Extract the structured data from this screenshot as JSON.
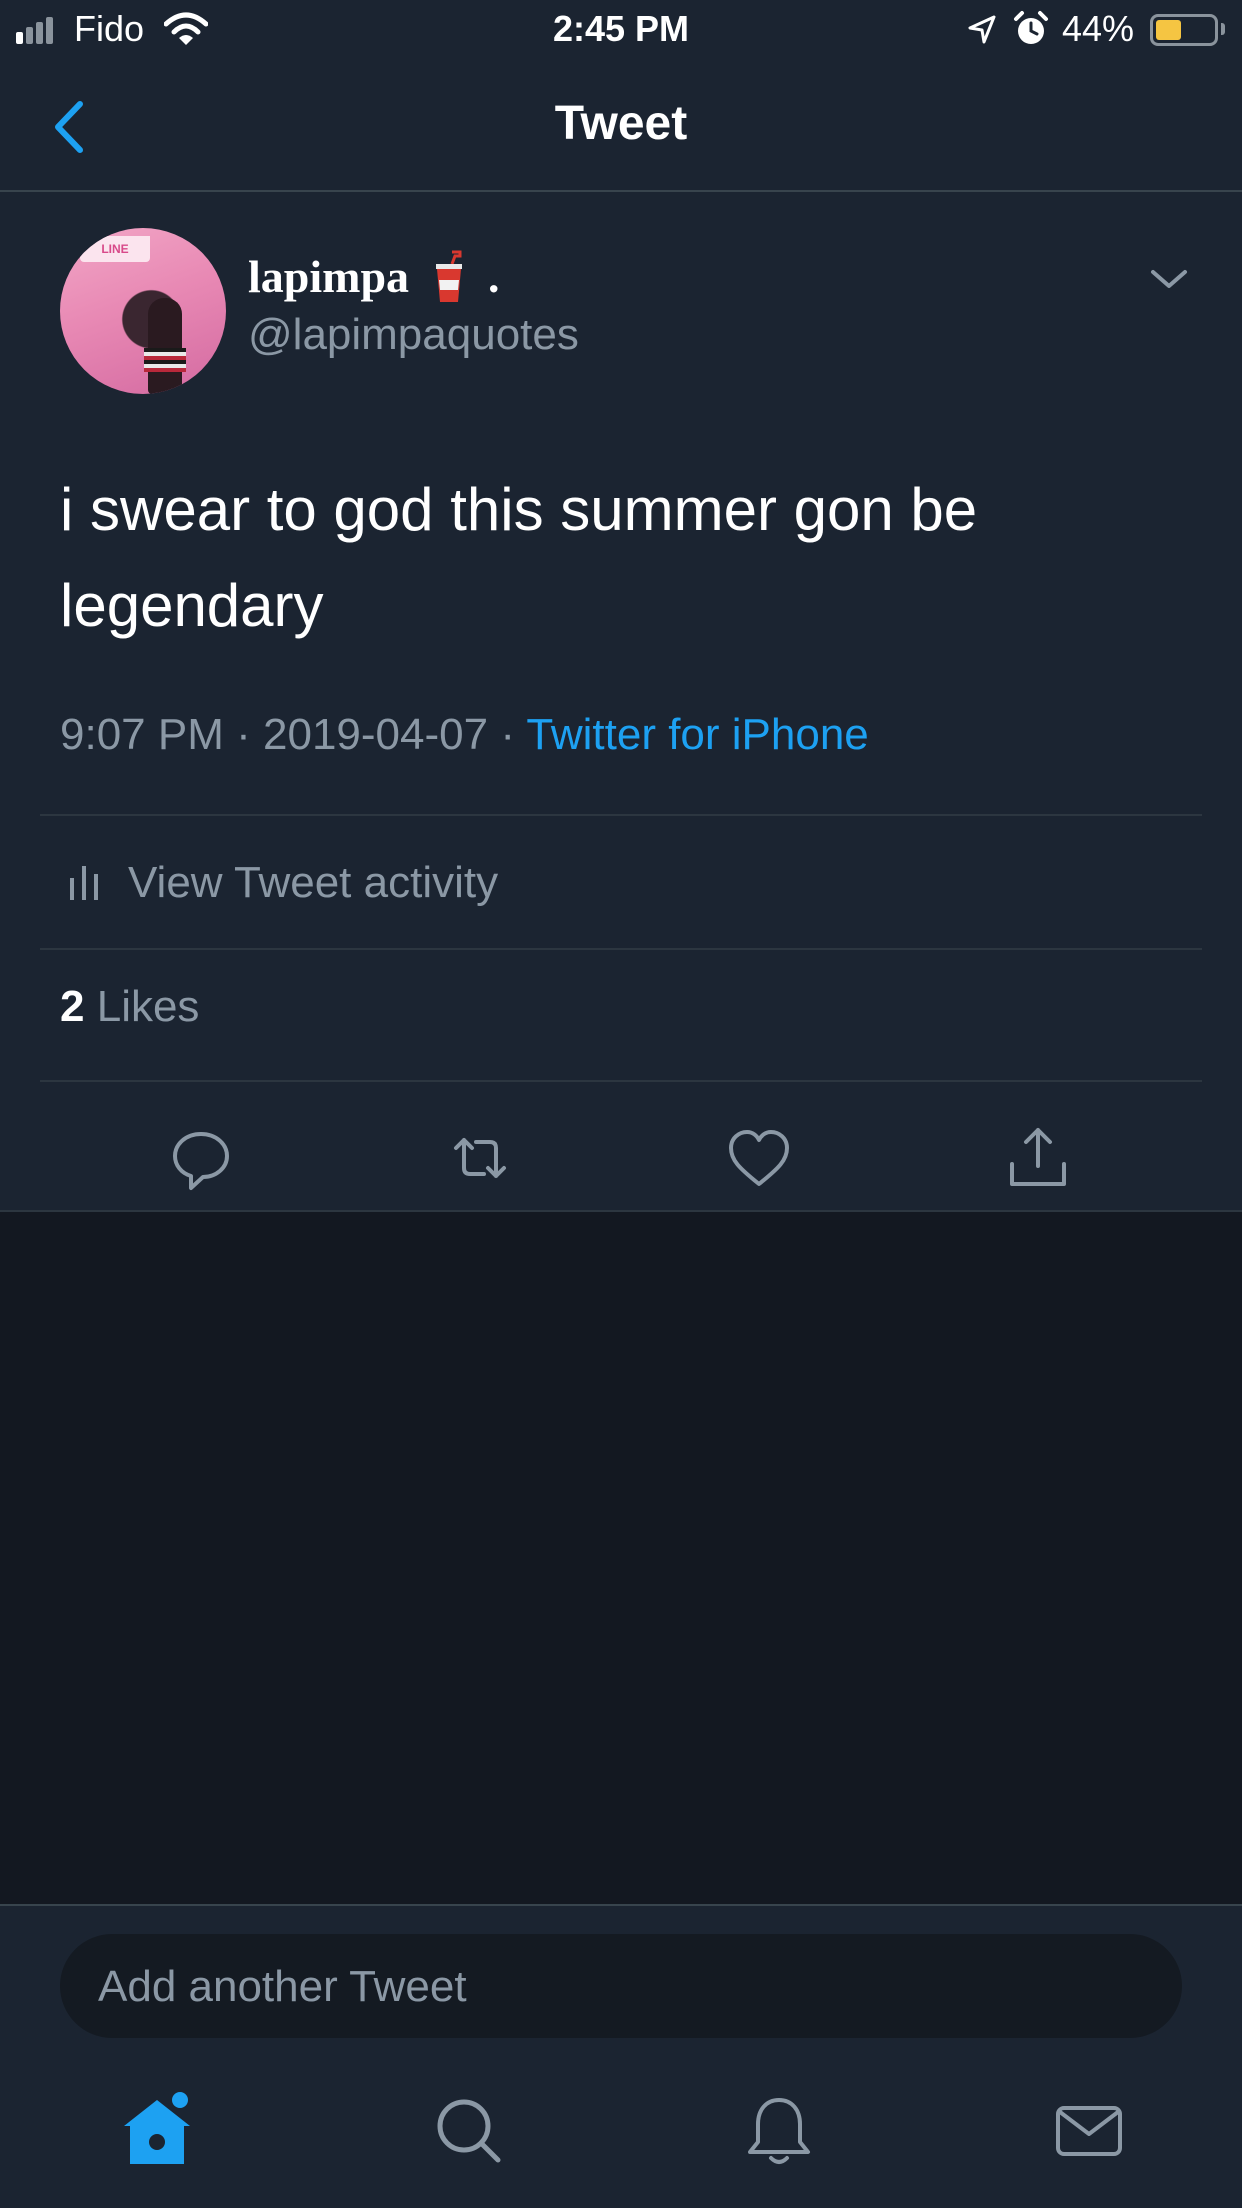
{
  "status_bar": {
    "carrier": "Fido",
    "time": "2:45 PM",
    "battery_percent_label": "44%",
    "battery_level": 0.44,
    "icons": [
      "signal-icon",
      "wifi-icon",
      "location-icon",
      "alarm-icon",
      "battery-icon"
    ]
  },
  "nav": {
    "title": "Tweet",
    "back_icon": "chevron-left-icon"
  },
  "tweet": {
    "author": {
      "display_name": "lapimpa",
      "name_suffix": ".",
      "handle": "@lapimpaquotes",
      "avatar_sign_text": "LINE"
    },
    "text": "i swear to god this summer gon be legendary",
    "time": "9:07 PM",
    "separator": "·",
    "date": "2019-04-07",
    "source": "Twitter for iPhone",
    "activity_label": "View Tweet activity",
    "likes_count": "2",
    "likes_label": "Likes",
    "actions": [
      "reply-icon",
      "retweet-icon",
      "like-icon",
      "share-icon"
    ]
  },
  "compose": {
    "placeholder": "Add another Tweet"
  },
  "tab_bar": {
    "tabs": [
      "home-icon",
      "search-icon",
      "notifications-icon",
      "messages-icon"
    ],
    "active": "home-icon"
  },
  "colors": {
    "accent": "#1da1f2",
    "background": "#131821",
    "card": "#1b2431",
    "secondary_text": "#8b98a5"
  }
}
